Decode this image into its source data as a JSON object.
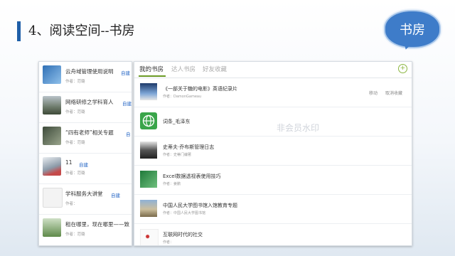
{
  "slide": {
    "title": "4、阅读空间--书房",
    "badge": "书房"
  },
  "left_list": [
    {
      "title": "云舟域管理使用说明",
      "author": "作者：范璐",
      "tag": "自建"
    },
    {
      "title": "网络研修之学科育人",
      "author": "作者：范璐",
      "tag": "自建"
    },
    {
      "title": "“四有老师”相关专题",
      "author": "作者：范璐",
      "tag": "自"
    },
    {
      "title": "11",
      "author": "作者：范璐",
      "tag": "自建"
    },
    {
      "title": "学科服务大讲堂",
      "author": "作者：",
      "tag": "自建"
    },
    {
      "title": "租在哪里，现在哪里——致",
      "author": "作者：范璐",
      "tag": ""
    }
  ],
  "tabs": [
    "我的书房",
    "达人书房",
    "好友收藏"
  ],
  "add_icon": "+",
  "books": [
    {
      "title": "《一部关于糖的电影》英语纪录片",
      "author": "作者：DamonGameau",
      "actions": [
        "移动",
        "取消收藏"
      ]
    },
    {
      "title": "词条_毛泽东",
      "author": "",
      "actions": []
    },
    {
      "title": "史蒂夫·乔布斯管理日志",
      "author": "作者：史蒂门编著",
      "actions": []
    },
    {
      "title": "Excel数据透视表使用技巧",
      "author": "作者：姜鹏",
      "actions": []
    },
    {
      "title": "中国人民大学图书馆入馆教育专题",
      "author": "作者：中国人民大学图书馆",
      "actions": []
    },
    {
      "title": "互联网时代的社交",
      "author": "作者：",
      "actions": []
    }
  ],
  "watermark": "非会员水印",
  "colors": {
    "accent": "#1f5fa8",
    "badge": "#3e7cc9",
    "link": "#2b6ac7",
    "tab_active": "#6a9a24"
  }
}
